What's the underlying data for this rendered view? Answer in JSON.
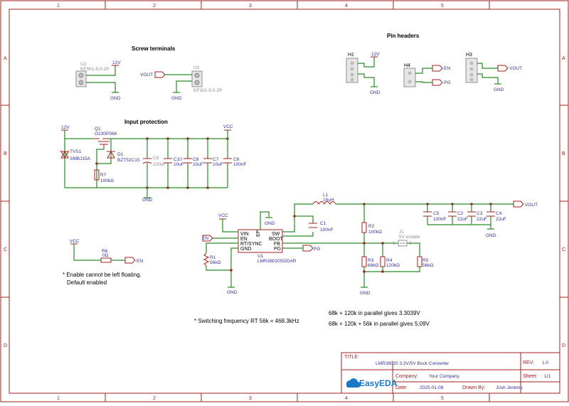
{
  "frame": {
    "col_labels": [
      "1",
      "2",
      "3",
      "4",
      "5"
    ],
    "row_labels": [
      "A",
      "B",
      "C",
      "D"
    ]
  },
  "sections": {
    "screw_terminals": "Screw terminals",
    "pin_headers": "Pin headers",
    "input_protection": "Input protection"
  },
  "components": {
    "U2": {
      "ref": "U2",
      "value": "KF301-5.0-2P"
    },
    "U3": {
      "ref": "U3",
      "value": "KF301-5.0-2P"
    },
    "H1": {
      "ref": "H1"
    },
    "H4": {
      "ref": "H4"
    },
    "H3": {
      "ref": "H3"
    },
    "Q1": {
      "ref": "Q1",
      "value": "G230P06K"
    },
    "TVS1": {
      "ref": "TVS1",
      "value": "SMBJ15A"
    },
    "D1": {
      "ref": "D1",
      "value": "BZT52C15"
    },
    "R7": {
      "ref": "R7",
      "value": "100kΩ"
    },
    "C9": {
      "ref": "C9",
      "value": "220uF"
    },
    "C10": {
      "ref": "C10",
      "value": "10uF"
    },
    "C8a": {
      "ref": "C8",
      "value": "10uF"
    },
    "C7": {
      "ref": "C7",
      "value": "10uF"
    },
    "C6": {
      "ref": "C6",
      "value": "100nF"
    },
    "L1": {
      "ref": "L1",
      "value": "15uH"
    },
    "C1": {
      "ref": "C1",
      "value": "100nF"
    },
    "U1": {
      "ref": "U1",
      "value": "LMR38020SDDAR"
    },
    "R1": {
      "ref": "R1",
      "value": "56kΩ"
    },
    "R2": {
      "ref": "R2",
      "value": "100kΩ"
    },
    "R3": {
      "ref": "R3",
      "value": "68kΩ"
    },
    "R4": {
      "ref": "R4",
      "value": "120kΩ"
    },
    "R5": {
      "ref": "R5",
      "value": "56kΩ"
    },
    "J1": {
      "ref": "J1",
      "value": "5V enable"
    },
    "C5": {
      "ref": "C5",
      "value": "100nF"
    },
    "C2": {
      "ref": "C2",
      "value": "22uF"
    },
    "C3": {
      "ref": "C3",
      "value": "22uF"
    },
    "C4": {
      "ref": "C4",
      "value": "22uF"
    },
    "R6": {
      "ref": "R6",
      "value": "0Ω"
    }
  },
  "u1_pins": {
    "vin": "VIN",
    "en": "EN",
    "rt": "RT/SYNC",
    "gnd": "GND",
    "ep": "EP",
    "sw": "SW",
    "boot": "BOOT",
    "fb": "FB",
    "pg": "PG"
  },
  "nets": {
    "v12": "12V",
    "vout": "VOUT",
    "gnd": "GND",
    "en": "EN",
    "pg": "PG",
    "vcc": "VCC"
  },
  "j1_pins": {
    "p1": "1",
    "p2": "2"
  },
  "notes": {
    "enable": "* Enable cannot be left floating.",
    "enable2": "Default enabled",
    "freq": "* Switching frequency RT 56k = 468.3kHz",
    "par1": "68k + 120k in parallel gives 3.3039V",
    "par2": "68k + 120k + 56k in parallel gives 5.09V"
  },
  "title_block": {
    "title_label": "TITLE:",
    "title": "LMR38020 3.3V/5V Buck Converter",
    "rev_label": "REV:",
    "rev": "1.0",
    "company_label": "Company:",
    "company": "Your Company",
    "sheet_label": "Sheet:",
    "sheet": "1/1",
    "date_label": "Date:",
    "date": "2025-01-08",
    "drawn_label": "Drawn By:",
    "drawn": "Josh Jenkins",
    "logo_text": "EasyEDA"
  },
  "colors": {
    "frame": "#a32020",
    "wire": "#2a8a2a",
    "text": "#3030a0"
  }
}
